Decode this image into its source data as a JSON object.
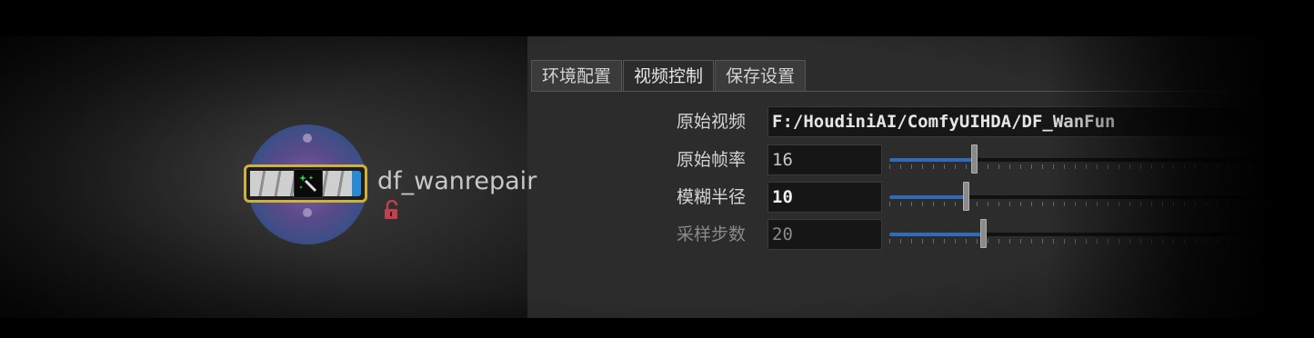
{
  "node": {
    "name": "df_wanrepair",
    "icon": "magic-wand-icon",
    "lock_icon": "unlock-icon",
    "border_color": "#d0b23a"
  },
  "tabs": [
    {
      "label": "环境配置",
      "active": false
    },
    {
      "label": "视频控制",
      "active": true
    },
    {
      "label": "保存设置",
      "active": false
    }
  ],
  "params": {
    "source_video": {
      "label": "原始视频",
      "value": "F:/HoudiniAI/ComfyUIHDA/DF_WanFun"
    },
    "source_fps": {
      "label": "原始帧率",
      "value": "16",
      "slider_fraction": 0.2
    },
    "blur_radius": {
      "label": "模糊半径",
      "value": "10",
      "slider_fraction": 0.18
    },
    "sample_steps": {
      "label": "采样步数",
      "value": "20",
      "slider_fraction": 0.22,
      "disabled": true
    }
  },
  "colors": {
    "accent": "#2f6bb8",
    "panel": "#2c2c2c",
    "field": "#161616"
  }
}
